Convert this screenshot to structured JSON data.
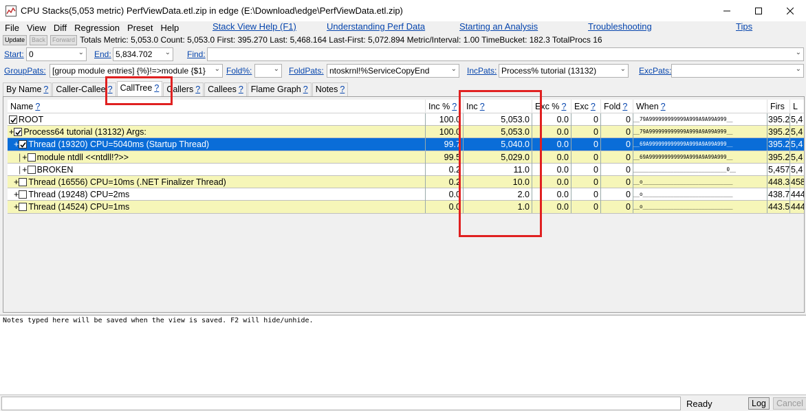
{
  "window": {
    "title": "CPU Stacks(5,053 metric) PerfViewData.etl.zip in edge (E:\\Download\\edge\\PerfViewData.etl.zip)"
  },
  "menu": {
    "items": [
      "File",
      "View",
      "Diff",
      "Regression",
      "Preset",
      "Help"
    ],
    "links": [
      "Stack View Help (F1)",
      "Understanding Perf Data",
      "Starting an Analysis",
      "Troubleshooting",
      "Tips"
    ]
  },
  "toolbar": {
    "update_label": "Update",
    "back_label": "Back",
    "forward_label": "Forward",
    "stats": "Totals Metric: 5,053.0  Count: 5,053.0  First: 395.270 Last: 5,468.164  Last-First: 5,072.894  Metric/Interval: 1.00  TimeBucket: 182.3  TotalProcs 16"
  },
  "filters": {
    "start_label": "Start:",
    "start_value": "0",
    "end_label": "End:",
    "end_value": "5,834.702",
    "find_label": "Find:",
    "find_value": "",
    "grouppats_label": "GroupPats:",
    "grouppats_value": "[group module entries]  {%}!=>module {$1}",
    "fold_label": "Fold%:",
    "fold_value": "",
    "foldpats_label": "FoldPats:",
    "foldpats_value": "ntoskrnl!%ServiceCopyEnd",
    "incpats_label": "IncPats:",
    "incpats_value": "Process% tutorial (13132)",
    "excpats_label": "ExcPats:",
    "excpats_value": ""
  },
  "tabs": [
    {
      "label": "By Name",
      "q": "?"
    },
    {
      "label": "Caller-Callee",
      "q": "?"
    },
    {
      "label": "CallTree",
      "q": "?"
    },
    {
      "label": "Callers",
      "q": "?"
    },
    {
      "label": "Callees",
      "q": "?"
    },
    {
      "label": "Flame Graph",
      "q": "?"
    },
    {
      "label": "Notes",
      "q": "?"
    }
  ],
  "grid": {
    "columns": [
      {
        "label": "Name",
        "q": "?"
      },
      {
        "label": "Inc %",
        "q": "?"
      },
      {
        "label": "Inc",
        "q": "?"
      },
      {
        "label": "Exc %",
        "q": "?"
      },
      {
        "label": "Exc",
        "q": "?"
      },
      {
        "label": "Fold",
        "q": "?"
      },
      {
        "label": "When",
        "q": "?"
      },
      {
        "label": "Firs",
        "q": ""
      },
      {
        "label": "L",
        "q": ""
      }
    ],
    "rows": [
      {
        "expander": "",
        "guide": "",
        "checked": true,
        "name": "ROOT",
        "inc_pct": "100.0",
        "inc": "5,053.0",
        "exc_pct": "0.0",
        "exc": "0",
        "fold": "0",
        "when": "__79A999999999999A999A9A99A999__",
        "first": "395.2",
        "last": "5,4",
        "style": "white"
      },
      {
        "expander": "+",
        "guide": "",
        "checked": true,
        "name": "Process64 tutorial (13132) Args:",
        "inc_pct": "100.0",
        "inc": "5,053.0",
        "exc_pct": "0.0",
        "exc": "0",
        "fold": "0",
        "when": "__79A999999999999A999A9A99A999__",
        "first": "395.2",
        "last": "5,4",
        "style": "yellow"
      },
      {
        "expander": "+",
        "guide": " ",
        "checked": true,
        "name": "Thread (19320) CPU=5040ms (Startup Thread)",
        "inc_pct": "99.7",
        "inc": "5,040.0",
        "exc_pct": "0.0",
        "exc": "0",
        "fold": "0",
        "when": "__69A999999999999A999A9A99A999__",
        "first": "395.2",
        "last": "5,4",
        "style": "selected"
      },
      {
        "expander": "+",
        "guide": " |",
        "checked": false,
        "name": "module ntdll <<ntdll!?>>",
        "inc_pct": "99.5",
        "inc": "5,029.0",
        "exc_pct": "0.0",
        "exc": "0",
        "fold": "0",
        "when": "__69A999999999999A999A9A99A999__",
        "first": "395.2",
        "last": "5,4",
        "style": "yellow"
      },
      {
        "expander": "+",
        "guide": " |",
        "checked": false,
        "name": "BROKEN",
        "inc_pct": "0.2",
        "inc": "11.0",
        "exc_pct": "0.0",
        "exc": "0",
        "fold": "0",
        "when": "______________________________0__",
        "first": "5,457",
        "last": "5,4",
        "style": "white"
      },
      {
        "expander": "+",
        "guide": " ",
        "checked": false,
        "name": "Thread (16556) CPU=10ms (.NET Finalizer Thread)",
        "inc_pct": "0.2",
        "inc": "10.0",
        "exc_pct": "0.0",
        "exc": "0",
        "fold": "0",
        "when": "__o_____________________________",
        "first": "448.3",
        "last": "458",
        "style": "yellow"
      },
      {
        "expander": "+",
        "guide": " ",
        "checked": false,
        "name": "Thread (19248) CPU=2ms",
        "inc_pct": "0.0",
        "inc": "2.0",
        "exc_pct": "0.0",
        "exc": "0",
        "fold": "0",
        "when": "__o_____________________________",
        "first": "438.7",
        "last": "444",
        "style": "white"
      },
      {
        "expander": "+",
        "guide": " ",
        "checked": false,
        "name": "Thread (14524) CPU=1ms",
        "inc_pct": "0.0",
        "inc": "1.0",
        "exc_pct": "0.0",
        "exc": "0",
        "fold": "0",
        "when": "__o_____________________________",
        "first": "443.5",
        "last": "444",
        "style": "yellow"
      }
    ]
  },
  "notes": {
    "text": "Notes typed here will be saved when the view is saved. F2 will hide/unhide."
  },
  "status": {
    "ready": "Ready",
    "log_label": "Log",
    "cancel_label": "Cancel"
  },
  "colors": {
    "link": "#0645ad",
    "row_yellow": "#f6f6b8",
    "row_selected": "#0a6dd8",
    "highlight_red": "#e02020"
  }
}
